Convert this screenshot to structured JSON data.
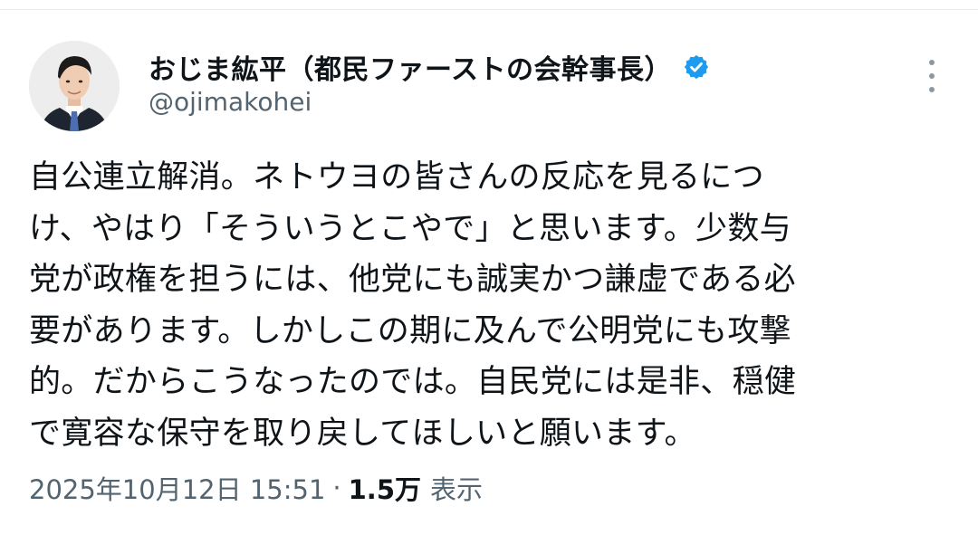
{
  "author": {
    "display_name": "おじま紘平（都民ファーストの会幹事長）",
    "handle": "@ojimakohei",
    "verified": true,
    "avatar_icon": "profile-photo"
  },
  "tweet": {
    "lines": [
      "自公連立解消。ネトウヨの皆さんの反応を見るにつ",
      "け、やはり「そういうとこやで」と思います。少数与",
      "党が政権を担うには、他党にも誠実かつ謙虚である必",
      "要があります。しかしこの期に及んで公明党にも攻撃",
      "的。だからこうなったのでは。自民党には是非、穏健",
      "で寛容な保守を取り戻してほしいと願います。"
    ]
  },
  "meta": {
    "timestamp": "2025年10月12日 15:51",
    "separator": "·",
    "views_count": "1.5万",
    "views_label": "表示"
  },
  "colors": {
    "verified_badge": "#1d9bf0",
    "text_primary": "#0f1419",
    "text_secondary": "#536471"
  },
  "icons": {
    "more": "more-vertical-icon",
    "verified": "verified-badge-icon"
  }
}
